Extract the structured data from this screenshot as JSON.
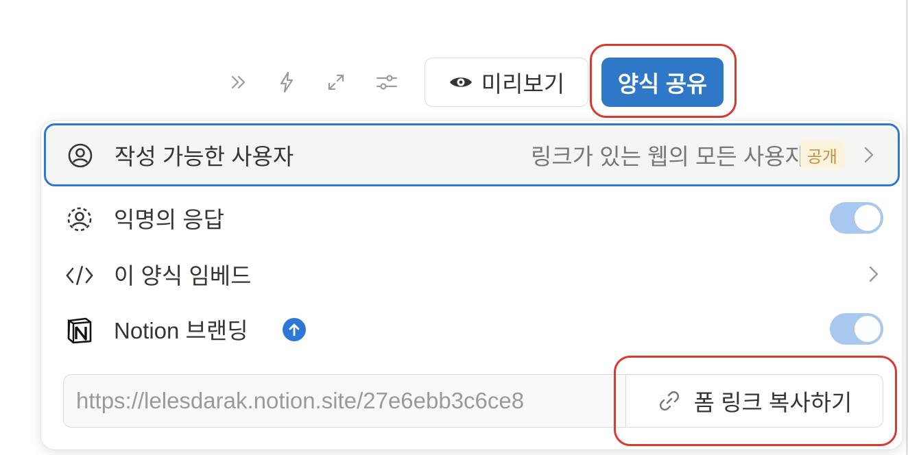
{
  "toolbar": {
    "icons": [
      "double-chevron-right-icon",
      "lightning-icon",
      "expand-icon",
      "sliders-icon"
    ],
    "preview_label": "미리보기",
    "share_label": "양식 공유"
  },
  "share_panel": {
    "access": {
      "label": "작성 가능한 사용자",
      "value": "링크가 있는 웹의 모든 사용자",
      "badge": "공개"
    },
    "anonymous": {
      "label": "익명의 응답",
      "enabled": true
    },
    "embed": {
      "label": "이 양식 임베드"
    },
    "branding": {
      "label": "Notion 브랜딩",
      "enabled": true
    },
    "link": {
      "url": "https://lelesdarak.notion.site/27e6ebb3c6ce8",
      "copy_label": "폼 링크 복사하기"
    }
  },
  "colors": {
    "accent": "#2f77c7",
    "highlight": "#d93a2f",
    "badge_bg": "#fbf3db",
    "badge_text": "#c29243",
    "toggle_on": "#a9c8ef"
  }
}
